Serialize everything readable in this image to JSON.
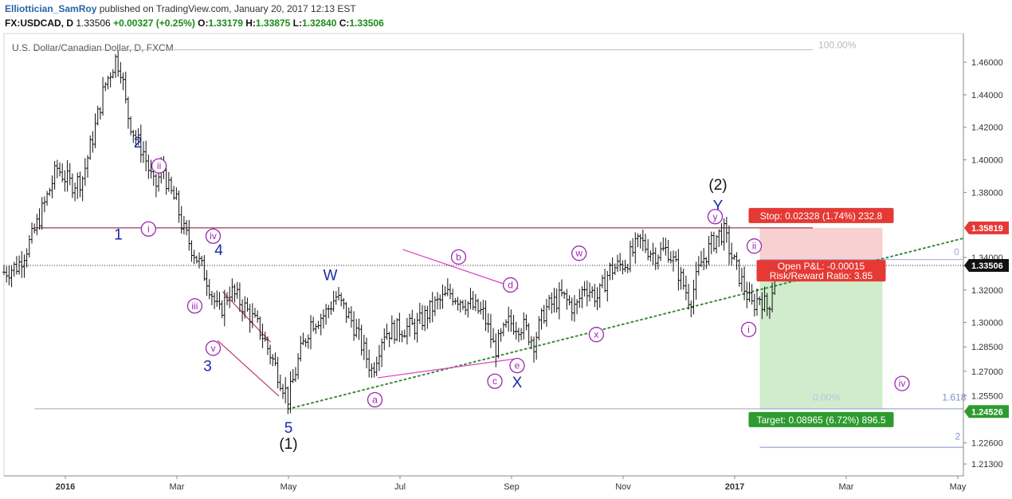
{
  "header": {
    "author": "Elliottician_SamRoy",
    "published_text": "published on TradingView.com, January 20, 2017 12:13 EST",
    "symbol": "FX:USDCAD, D",
    "last": "1.33506",
    "change": "+0.00327 (+0.25%)",
    "open_label": "O:",
    "open": "1.33179",
    "high_label": "H:",
    "high": "1.33875",
    "low_label": "L:",
    "low": "1.32840",
    "close_label": "C:",
    "close": "1.33506"
  },
  "chart_data": {
    "type": "candlestick",
    "title": "U.S. Dollar/Canadian Dollar, D, FXCM",
    "x_ticks": [
      {
        "t": 0,
        "label": "2016"
      },
      {
        "t": 2,
        "label": "Mar"
      },
      {
        "t": 4,
        "label": "May"
      },
      {
        "t": 6,
        "label": "Jul"
      },
      {
        "t": 8,
        "label": "Sep"
      },
      {
        "t": 10,
        "label": "Nov"
      },
      {
        "t": 12,
        "label": "2017"
      },
      {
        "t": 14,
        "label": "Mar"
      },
      {
        "t": 16,
        "label": "May"
      }
    ],
    "x_domain": [
      -1.1,
      16.1
    ],
    "y_domain": [
      1.2057,
      1.4777
    ],
    "y_ticks": [
      "1.46000",
      "1.44000",
      "1.42000",
      "1.40000",
      "1.38000",
      "1.34000",
      "1.33491",
      "1.32000",
      "1.30000",
      "1.28500",
      "1.27000",
      "1.25500",
      "1.22600",
      "1.21300"
    ],
    "price_series": [
      {
        "t": -1.1,
        "p": 1.331
      },
      {
        "t": -0.85,
        "p": 1.335
      },
      {
        "t": -0.6,
        "p": 1.352
      },
      {
        "t": -0.35,
        "p": 1.375
      },
      {
        "t": -0.15,
        "p": 1.395
      },
      {
        "t": 0.1,
        "p": 1.385
      },
      {
        "t": 0.3,
        "p": 1.388
      },
      {
        "t": 0.5,
        "p": 1.415
      },
      {
        "t": 0.7,
        "p": 1.445
      },
      {
        "t": 0.9,
        "p": 1.462
      },
      {
        "t": 1.0,
        "p": 1.456
      },
      {
        "t": 1.1,
        "p": 1.43
      },
      {
        "t": 1.25,
        "p": 1.414
      },
      {
        "t": 1.4,
        "p": 1.405
      },
      {
        "t": 1.6,
        "p": 1.382
      },
      {
        "t": 1.75,
        "p": 1.396
      },
      {
        "t": 1.85,
        "p": 1.382
      },
      {
        "t": 2.0,
        "p": 1.373
      },
      {
        "t": 2.1,
        "p": 1.358
      },
      {
        "t": 2.35,
        "p": 1.34
      },
      {
        "t": 2.55,
        "p": 1.326
      },
      {
        "t": 2.75,
        "p": 1.305
      },
      {
        "t": 2.95,
        "p": 1.32
      },
      {
        "t": 3.2,
        "p": 1.31
      },
      {
        "t": 3.5,
        "p": 1.295
      },
      {
        "t": 3.8,
        "p": 1.27
      },
      {
        "t": 4.0,
        "p": 1.253
      },
      {
        "t": 4.2,
        "p": 1.28
      },
      {
        "t": 4.4,
        "p": 1.3
      },
      {
        "t": 4.65,
        "p": 1.305
      },
      {
        "t": 4.85,
        "p": 1.316
      },
      {
        "t": 5.15,
        "p": 1.3
      },
      {
        "t": 5.5,
        "p": 1.27
      },
      {
        "t": 5.7,
        "p": 1.294
      },
      {
        "t": 6.0,
        "p": 1.296
      },
      {
        "t": 6.3,
        "p": 1.298
      },
      {
        "t": 6.6,
        "p": 1.31
      },
      {
        "t": 6.9,
        "p": 1.318
      },
      {
        "t": 7.2,
        "p": 1.312
      },
      {
        "t": 7.5,
        "p": 1.305
      },
      {
        "t": 7.7,
        "p": 1.283
      },
      {
        "t": 7.95,
        "p": 1.3
      },
      {
        "t": 8.2,
        "p": 1.298
      },
      {
        "t": 8.4,
        "p": 1.288
      },
      {
        "t": 8.6,
        "p": 1.308
      },
      {
        "t": 8.9,
        "p": 1.316
      },
      {
        "t": 9.15,
        "p": 1.308
      },
      {
        "t": 9.3,
        "p": 1.323
      },
      {
        "t": 9.55,
        "p": 1.315
      },
      {
        "t": 9.75,
        "p": 1.332
      },
      {
        "t": 10.05,
        "p": 1.337
      },
      {
        "t": 10.3,
        "p": 1.35
      },
      {
        "t": 10.55,
        "p": 1.342
      },
      {
        "t": 10.8,
        "p": 1.345
      },
      {
        "t": 11.0,
        "p": 1.33
      },
      {
        "t": 11.2,
        "p": 1.313
      },
      {
        "t": 11.4,
        "p": 1.337
      },
      {
        "t": 11.65,
        "p": 1.352
      },
      {
        "t": 11.8,
        "p": 1.356
      },
      {
        "t": 11.95,
        "p": 1.34
      },
      {
        "t": 12.15,
        "p": 1.323
      },
      {
        "t": 12.3,
        "p": 1.31
      },
      {
        "t": 12.45,
        "p": 1.316
      },
      {
        "t": 12.6,
        "p": 1.308
      },
      {
        "t": 12.75,
        "p": 1.335
      }
    ],
    "current_price": 1.33506,
    "horizontal_lines": [
      {
        "p": 1.3582,
        "x1": -0.55,
        "x2": 13.4,
        "color": "#7a0f2a"
      },
      {
        "p": 1.4677,
        "x1": -0.55,
        "x2": 13.4,
        "color": "#bdbdbd"
      },
      {
        "p": 1.2469,
        "x1": -0.55,
        "x2": 16.1,
        "color": "#a8a8a8"
      },
      {
        "p": 1.3387,
        "x1": 12.45,
        "x2": 16.1,
        "color": "#9aa8d8"
      },
      {
        "p": 1.2469,
        "x1": 12.45,
        "x2": 16.1,
        "color": "#9aa8d8"
      },
      {
        "p": 1.2233,
        "x1": 12.45,
        "x2": 16.1,
        "color": "#8090d0"
      }
    ],
    "trend_lines": [
      {
        "t1": 4.0,
        "p1": 1.2469,
        "t2": 16.1,
        "p2": 1.3518,
        "color": "#3a8c3a",
        "style": "dotted"
      },
      {
        "t1": 5.6,
        "p1": 1.266,
        "t2": 8.05,
        "p2": 1.2776,
        "color": "#e040c0",
        "style": "solid"
      },
      {
        "t1": 6.05,
        "p1": 1.3449,
        "t2": 8.12,
        "p2": 1.3207,
        "color": "#e040c0",
        "style": "solid"
      },
      {
        "t1": 2.82,
        "p1": 1.3189,
        "t2": 3.68,
        "p2": 1.2879,
        "color": "#c23a5c",
        "style": "solid"
      },
      {
        "t1": 2.73,
        "p1": 1.2889,
        "t2": 3.83,
        "p2": 1.2547,
        "color": "#c23a5c",
        "style": "solid"
      }
    ],
    "fib_labels": [
      {
        "text": "100.00%",
        "t": 13.5,
        "p": 1.4677,
        "color": "#b8b8b8"
      },
      {
        "text": "0.00%",
        "t": 13.4,
        "p": 1.2511,
        "color": "#b8c4e8"
      },
      {
        "text": "1.618",
        "t": 15.72,
        "p": 1.2511,
        "color": "#8090d0"
      },
      {
        "text": "0",
        "t": 15.93,
        "p": 1.3405,
        "color": "#9aa8d8"
      },
      {
        "text": "2",
        "t": 15.95,
        "p": 1.227,
        "color": "#8090d0"
      }
    ],
    "position_tool": {
      "t1": 12.45,
      "t2": 14.65,
      "entry": 1.335,
      "stop": 1.3582,
      "target": 1.2469,
      "stop_label": "Stop: 0.02328 (1.74%) 232.8",
      "pnl_label": "Open P&L: -0.00015",
      "rr_label": "Risk/Reward Ratio: 3.85",
      "target_label": "Target: 0.08965 (6.72%) 896.5"
    },
    "price_tags": [
      {
        "text": "1.35819",
        "p": 1.35819,
        "bg": "#e53935",
        "fg": "#ffffff"
      },
      {
        "text": "1.33506",
        "p": 1.33506,
        "bg": "#111111",
        "fg": "#ffffff"
      },
      {
        "text": "1.24526",
        "p": 1.24526,
        "bg": "#2e9b2e",
        "fg": "#ffffff"
      }
    ],
    "wave_labels": [
      {
        "text": "1",
        "t": 0.95,
        "p": 1.3545,
        "style": "blue"
      },
      {
        "text": "2",
        "t": 1.3,
        "p": 1.411,
        "style": "blue"
      },
      {
        "text": "3",
        "t": 2.55,
        "p": 1.2736,
        "style": "blue"
      },
      {
        "text": "4",
        "t": 2.75,
        "p": 1.345,
        "style": "blue"
      },
      {
        "text": "5",
        "t": 4.0,
        "p": 1.2357,
        "style": "blue"
      },
      {
        "text": "W",
        "t": 4.75,
        "p": 1.3294,
        "style": "blue"
      },
      {
        "text": "X",
        "t": 8.1,
        "p": 1.2635,
        "style": "blue"
      },
      {
        "text": "Y",
        "t": 11.7,
        "p": 1.3722,
        "style": "blue"
      },
      {
        "text": "(1)",
        "t": 4.0,
        "p": 1.2258,
        "style": "black"
      },
      {
        "text": "(2)",
        "t": 11.7,
        "p": 1.385,
        "style": "black"
      },
      {
        "text": "i",
        "t": 1.49,
        "p": 1.3575,
        "style": "circle"
      },
      {
        "text": "ii",
        "t": 1.68,
        "p": 1.3963,
        "style": "circle"
      },
      {
        "text": "iii",
        "t": 2.32,
        "p": 1.3102,
        "style": "circle"
      },
      {
        "text": "iv",
        "t": 2.65,
        "p": 1.3531,
        "style": "circle"
      },
      {
        "text": "v",
        "t": 2.65,
        "p": 1.2842,
        "style": "circle"
      },
      {
        "text": "a",
        "t": 5.55,
        "p": 1.2525,
        "style": "circle"
      },
      {
        "text": "b",
        "t": 7.05,
        "p": 1.3403,
        "style": "circle"
      },
      {
        "text": "c",
        "t": 7.7,
        "p": 1.2639,
        "style": "circle"
      },
      {
        "text": "d",
        "t": 7.98,
        "p": 1.3231,
        "style": "circle"
      },
      {
        "text": "e",
        "t": 8.1,
        "p": 1.2735,
        "style": "circle"
      },
      {
        "text": "w",
        "t": 9.21,
        "p": 1.3426,
        "style": "circle"
      },
      {
        "text": "x",
        "t": 9.52,
        "p": 1.2926,
        "style": "circle"
      },
      {
        "text": "y",
        "t": 11.65,
        "p": 1.3651,
        "style": "circle"
      },
      {
        "text": "i",
        "t": 12.25,
        "p": 1.2957,
        "style": "circle"
      },
      {
        "text": "ii",
        "t": 12.35,
        "p": 1.347,
        "style": "circle"
      },
      {
        "text": "iv",
        "t": 15.0,
        "p": 1.2625,
        "style": "circle"
      }
    ]
  }
}
